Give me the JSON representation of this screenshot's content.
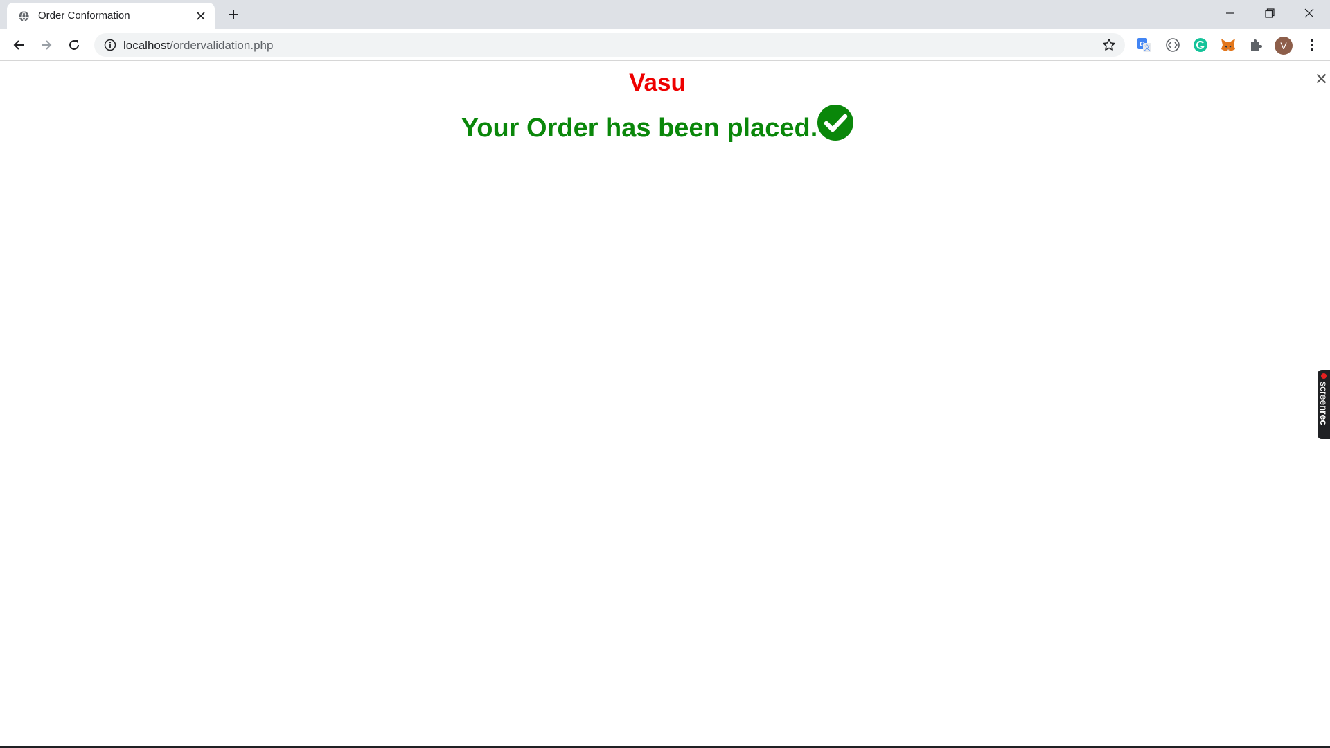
{
  "browser": {
    "tab_title": "Order Conformation",
    "url_host": "localhost",
    "url_path": "/ordervalidation.php",
    "profile_initial": "V",
    "extensions": [
      "google-translate-icon",
      "code-icon",
      "grammarly-icon",
      "metamask-icon",
      "extensions-puzzle-icon"
    ]
  },
  "page": {
    "customer_name": "Vasu",
    "confirmation_message": "Your Order has been placed.",
    "name_color": "#ee0000",
    "message_color": "#0a870a"
  },
  "overlay": {
    "recorder_brand_light": "screen",
    "recorder_brand_bold": "rec"
  }
}
